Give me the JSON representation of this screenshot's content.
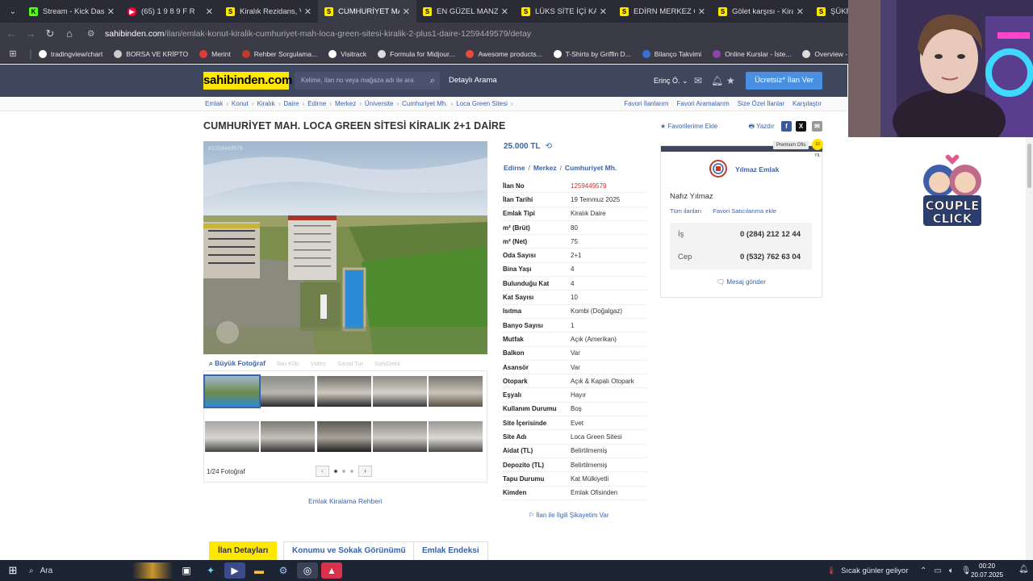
{
  "browser": {
    "tabs": [
      {
        "title": "Stream - Kick Dashbo",
        "fav": "K",
        "favcolor": "#53fc18"
      },
      {
        "title": "(65) 1 9 8 9   F R",
        "fav": "▶",
        "favcolor": "#ff0033"
      },
      {
        "title": "Kiralık Rezidans, Villa",
        "fav": "S",
        "favcolor": "#ffe800"
      },
      {
        "title": "CUMHURİYET MAH. L",
        "fav": "S",
        "favcolor": "#ffe800"
      },
      {
        "title": "EN GÜZEL MANZARA",
        "fav": "S",
        "favcolor": "#ffe800"
      },
      {
        "title": "LÜKS SİTE İÇİ KAP OT",
        "fav": "S",
        "favcolor": "#ffe800"
      },
      {
        "title": "EDİRN MERKEZ CUM",
        "fav": "S",
        "favcolor": "#ffe800"
      },
      {
        "title": "Gölet karşısı - Kiralık",
        "fav": "S",
        "favcolor": "#ffe800"
      },
      {
        "title": "ŞÜKR",
        "fav": "S",
        "favcolor": "#ffe800"
      }
    ],
    "url_host": "sahibinden.com",
    "url_path": "/ilan/emlak-konut-kiralik-cumhuriyet-mah-loca-green-sitesi-kiralik-2-plus1-daire-1259449579/detay",
    "bookmarks": [
      {
        "label": "tradingview/chart",
        "color": "#ffffff"
      },
      {
        "label": "BORSA VE KRİPTO",
        "color": "#cccccc"
      },
      {
        "label": "Merint",
        "color": "#e03a3a"
      },
      {
        "label": "Rehber Sorgulama...",
        "color": "#c0392b"
      },
      {
        "label": "Visitrack",
        "color": "#ffffff"
      },
      {
        "label": "Formula for Midjour...",
        "color": "#dddddd"
      },
      {
        "label": "Awesome products...",
        "color": "#e74c3c"
      },
      {
        "label": "T-Shirts by Griffin D...",
        "color": "#ffffff"
      },
      {
        "label": "Bilanço Takvimi",
        "color": "#3a6fd8"
      },
      {
        "label": "Online Kurslar - İste...",
        "color": "#8e44ad"
      },
      {
        "label": "Overview - Home A...",
        "color": "#dddddd"
      }
    ]
  },
  "header": {
    "logo": "sahibinden.com",
    "search_placeholder": "Kelime, ilan no veya mağaza adı ile ara",
    "advanced_search": "Detaylı Arama",
    "user": "Erinç Ö.",
    "cta": "Ücretsiz* İlan Ver"
  },
  "breadcrumb": [
    "Emlak",
    "Konut",
    "Kiralık",
    "Daire",
    "Edirne",
    "Merkez",
    "Üniversite",
    "Cumhuriyet Mh.",
    "Loca Green Sitesi"
  ],
  "top_links": [
    "Favori İlanlarım",
    "Favori Aramalarım",
    "Size Özel İlanlar",
    "Karşılaştır"
  ],
  "listing": {
    "title": "CUMHURİYET MAH. LOCA GREEN SİTESİ KİRALIK 2+1 DAİRE",
    "add_favorite": "Favorilerime Ekle",
    "print": "Yazdır",
    "photo_id": "#1259449579",
    "big_photo": "Büyük Fotoğraf",
    "disabled_tools": [
      "İlan Kliki",
      "Video",
      "Sanal Tur",
      "SahiDekk"
    ],
    "photo_count": "1/24 Fotoğraf",
    "rent_guide": "Emlak Kiralama Rehberi",
    "price": "25.000 TL",
    "location": [
      "Edirne",
      "Merkez",
      "Cumhuriyet Mh."
    ],
    "details": [
      {
        "k": "İlan No",
        "v": "1259449579"
      },
      {
        "k": "İlan Tarihi",
        "v": "19 Temmuz 2025"
      },
      {
        "k": "Emlak Tipi",
        "v": "Kiralık Daire"
      },
      {
        "k": "m² (Brüt)",
        "v": "80"
      },
      {
        "k": "m² (Net)",
        "v": "75"
      },
      {
        "k": "Oda Sayısı",
        "v": "2+1"
      },
      {
        "k": "Bina Yaşı",
        "v": "4"
      },
      {
        "k": "Bulunduğu Kat",
        "v": "4"
      },
      {
        "k": "Kat Sayısı",
        "v": "10"
      },
      {
        "k": "Isıtma",
        "v": "Kombi (Doğalgaz)"
      },
      {
        "k": "Banyo Sayısı",
        "v": "1"
      },
      {
        "k": "Mutfak",
        "v": "Açık (Amerikan)"
      },
      {
        "k": "Balkon",
        "v": "Var"
      },
      {
        "k": "Asansör",
        "v": "Var"
      },
      {
        "k": "Otopark",
        "v": "Açık & Kapalı Otopark"
      },
      {
        "k": "Eşyalı",
        "v": "Hayır"
      },
      {
        "k": "Kullanım Durumu",
        "v": "Boş"
      },
      {
        "k": "Site İçerisinde",
        "v": "Evet"
      },
      {
        "k": "Site Adı",
        "v": "Loca Green Sitesi"
      },
      {
        "k": "Aidat (TL)",
        "v": "Belirtilmemiş"
      },
      {
        "k": "Depozito (TL)",
        "v": "Belirtilmemiş"
      },
      {
        "k": "Tapu Durumu",
        "v": "Kat Mülkiyetli"
      },
      {
        "k": "Kimden",
        "v": "Emlak Ofisinden"
      }
    ],
    "complaint": "İlan ile İlgili Şikayetim Var"
  },
  "seller": {
    "premium": "Premium Ofis",
    "badge": "10 YIL",
    "firm": "Yılmaz Emlak",
    "name": "Nafız Yılmaz",
    "all_listings": "Tüm ilanları",
    "add_favorite_seller": "Favori Satıcılarıma ekle",
    "phones": [
      {
        "label": "İş",
        "number": "0 (284) 212 12 44"
      },
      {
        "label": "Cep",
        "number": "0 (532) 762 63 04"
      }
    ],
    "message": "Mesaj gönder"
  },
  "bottom_tabs": [
    "İlan Detayları",
    "Konumu ve Sokak Görünümü",
    "Emlak Endeksi"
  ],
  "overlay": {
    "brand_line1": "COUPLE",
    "brand_line2": "CLICK"
  },
  "taskbar": {
    "search": "Ara",
    "weather": "Sıcak günler geliyor",
    "time": "00:20",
    "date": "20.07.2025"
  }
}
